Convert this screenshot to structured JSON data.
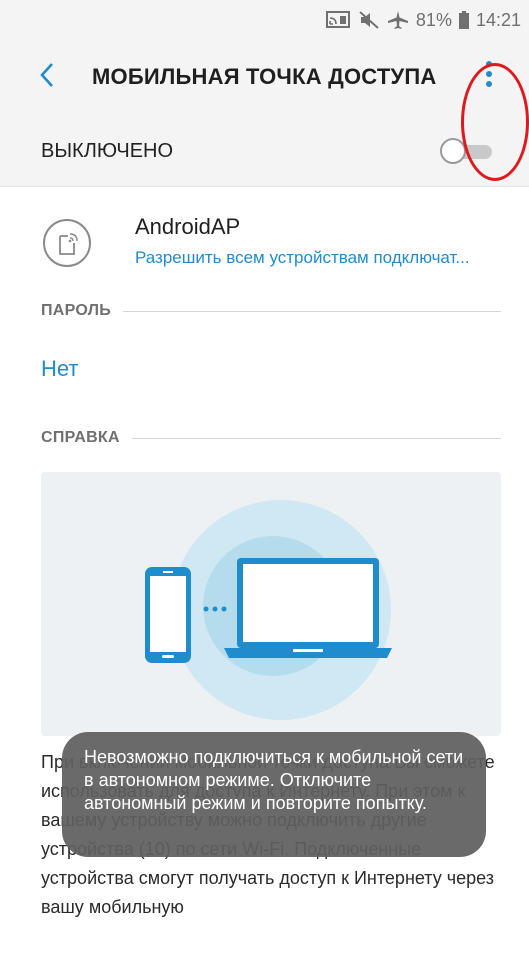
{
  "status_bar": {
    "battery": "81%",
    "time": "14:21",
    "icons": [
      "screen-mirror-icon",
      "mute-icon",
      "airplane-mode-icon",
      "battery-icon"
    ]
  },
  "header": {
    "title": "МОБИЛЬНАЯ ТОЧКА ДОСТУПА",
    "back_icon": "chevron-left-icon",
    "more_icon": "more-vert-icon"
  },
  "master_switch": {
    "label": "ВЫКЛЮЧЕНО",
    "on": false
  },
  "network": {
    "name": "AndroidAP",
    "subtitle": "Разрешить всем устройствам подключат...",
    "icon": "hotspot-device-icon"
  },
  "password_section": {
    "header": "ПАРОЛЬ",
    "value": "Нет"
  },
  "help_section": {
    "header": "СПРАВКА",
    "text": "При включении мобильной точки доступа Вы сможете использовать для доступа к Интернету. При этом к вашему устройству можно подключить другие устройства (10) по сети Wi-Fi. Подключенные устройства смогут получать доступ к Интернету через вашу мобильную"
  },
  "toast": {
    "message": "Невозможно подключиться к мобильной сети в автономном режиме. Отключите автономный режим и повторите попытку."
  },
  "colors": {
    "accent": "#1f8ccd",
    "annotation": "#e0191e",
    "toast_bg": "#5f5f5f",
    "header_bg": "#f4f4f4"
  }
}
